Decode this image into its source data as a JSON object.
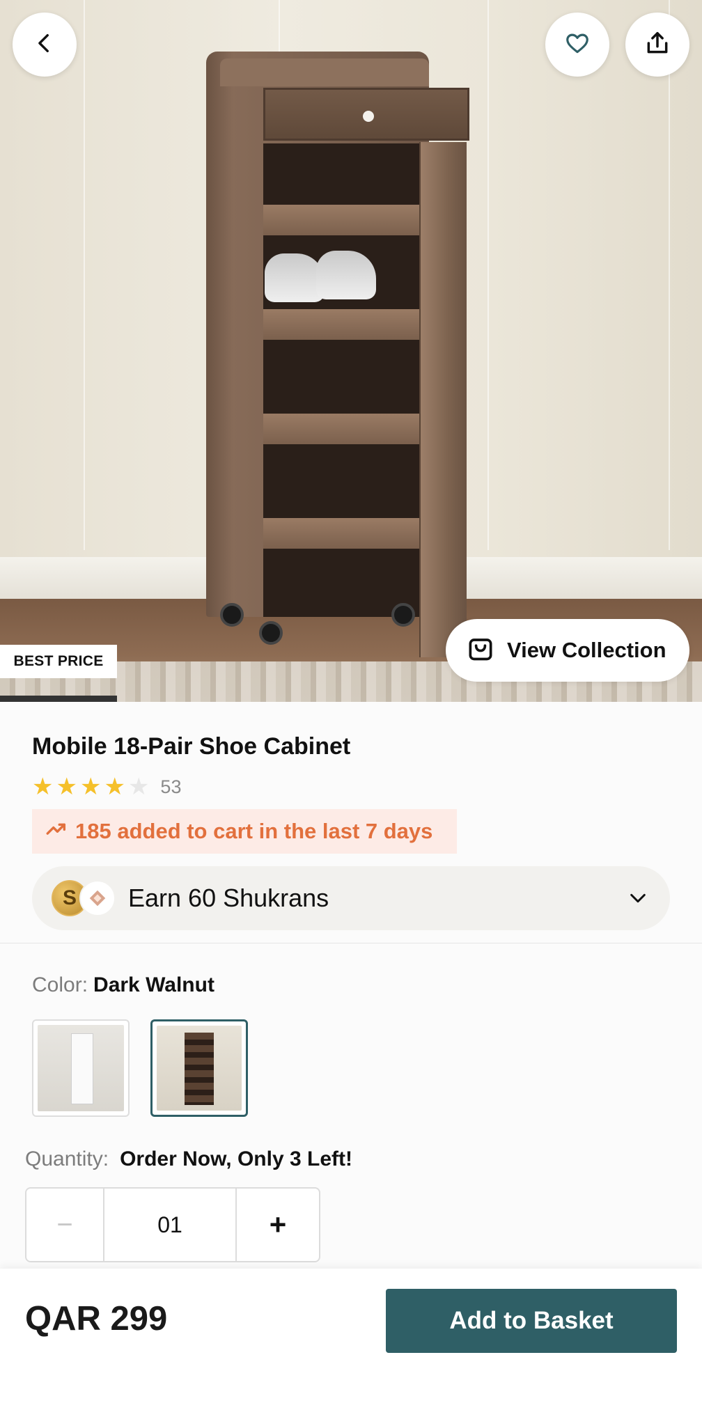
{
  "hero": {
    "badge_text": "BEST PRICE",
    "view_collection_label": "View Collection"
  },
  "product": {
    "title": "Mobile 18-Pair Shoe Cabinet",
    "rating": 4,
    "rating_max": 5,
    "review_count": "53",
    "trend_text": "185 added to cart in the last 7 days"
  },
  "rewards": {
    "label": "Earn 60 Shukrans",
    "coin_letter": "S"
  },
  "color": {
    "label": "Color:",
    "selected": "Dark Walnut",
    "options": [
      "white",
      "dark-walnut"
    ]
  },
  "quantity": {
    "label": "Quantity:",
    "stock_message": "Order Now, Only 3 Left!",
    "value": "01",
    "minus": "−",
    "plus": "+"
  },
  "footer": {
    "price": "QAR 299",
    "cta_label": "Add to Basket"
  },
  "colors": {
    "accent": "#2f5f66",
    "trend_text": "#e2703d",
    "trend_bg": "#fdebe6",
    "star": "#f5c02a"
  },
  "icons": [
    "back-arrow-icon",
    "heart-icon",
    "share-icon",
    "bag-icon",
    "trending-up-icon",
    "chevron-down-icon",
    "star-icon"
  ]
}
